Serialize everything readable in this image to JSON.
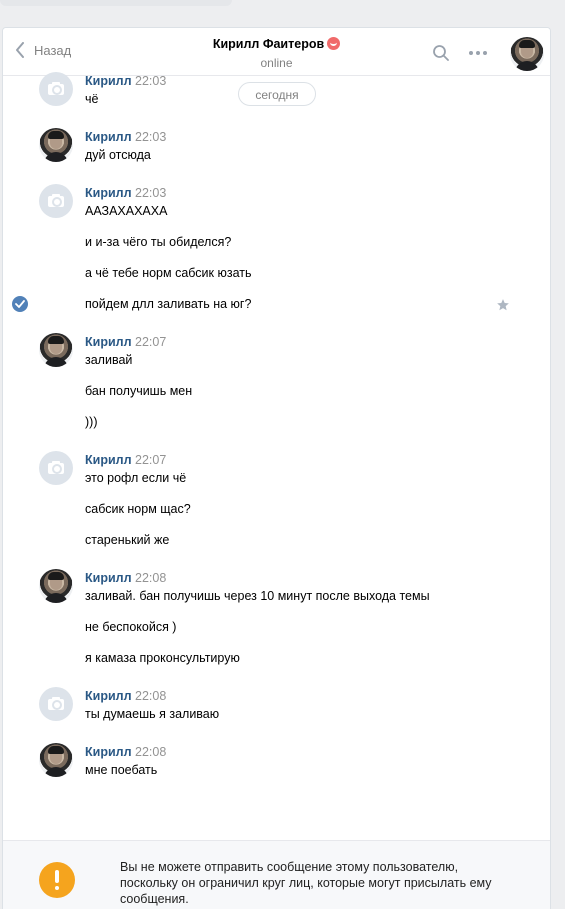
{
  "header": {
    "back_label": "Назад",
    "peer_name": "Кирилл Фаитеров",
    "peer_status": "online"
  },
  "date_separator": "сегодня",
  "messages": [
    {
      "author": "Кирилл",
      "time": "22:03",
      "lines": [
        "чё"
      ]
    },
    {
      "author": "Кирилл",
      "time": "22:03",
      "lines": [
        "дуй отсюда"
      ]
    },
    {
      "author": "Кирилл",
      "time": "22:03",
      "lines": [
        "ААЗАХАХАХА",
        "и и-за чёго ты обиделся?",
        "а чё тебе норм сабсик юзать",
        "пойдем длл заливать на юг?"
      ]
    },
    {
      "author": "Кирилл",
      "time": "22:07",
      "lines": [
        "заливай",
        "бан получишь мен",
        ")))"
      ]
    },
    {
      "author": "Кирилл",
      "time": "22:07",
      "lines": [
        "это рофл если чё",
        "сабсик норм щас?",
        "старенький же"
      ]
    },
    {
      "author": "Кирилл",
      "time": "22:08",
      "lines": [
        "заливай. бан получишь через 10 минут после выхода темы",
        "не беспокойся )",
        "я камаза проконсультирую"
      ]
    },
    {
      "author": "Кирилл",
      "time": "22:08",
      "lines": [
        "ты думаешь я заливаю"
      ]
    },
    {
      "author": "Кирилл",
      "time": "22:08",
      "lines": [
        "мне поебать"
      ]
    }
  ],
  "footer": {
    "notice": "Вы не можете отправить сообщение этому пользователю, поскольку он ограничил круг лиц, которые могут присылать ему сообщения."
  },
  "icons": {
    "back": "chevron-left-icon",
    "search": "search-icon",
    "more": "more-dots-icon",
    "selected": "check-circle-icon",
    "favorite": "star-icon",
    "warning": "exclamation-icon"
  },
  "colors": {
    "author": "#2a5885",
    "accent": "#5181b8",
    "warning": "#f5a41e"
  }
}
